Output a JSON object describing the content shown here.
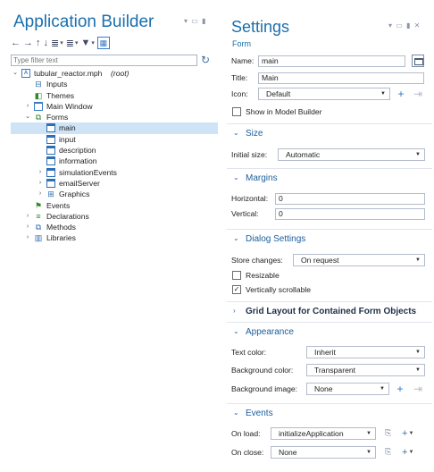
{
  "app_builder": {
    "title": "Application Builder",
    "filter_placeholder": "Type filter text",
    "tree": [
      {
        "label": "tubular_reactor.mph",
        "suffix": "(root)",
        "level": 0,
        "expanded": true,
        "icon": "application-icon"
      },
      {
        "label": "Inputs",
        "level": 1,
        "icon": "inputs-icon"
      },
      {
        "label": "Themes",
        "level": 1,
        "icon": "themes-icon"
      },
      {
        "label": "Main Window",
        "level": 1,
        "collapsed": true,
        "icon": "main-window-icon"
      },
      {
        "label": "Forms",
        "level": 1,
        "expanded": true,
        "icon": "forms-icon"
      },
      {
        "label": "main",
        "level": 2,
        "selected": true,
        "icon": "form-icon"
      },
      {
        "label": "input",
        "level": 2,
        "icon": "form-icon"
      },
      {
        "label": "description",
        "level": 2,
        "icon": "form-icon"
      },
      {
        "label": "information",
        "level": 2,
        "icon": "form-icon"
      },
      {
        "label": "simulationEvents",
        "level": 2,
        "collapsed": true,
        "icon": "form-icon"
      },
      {
        "label": "emailServer",
        "level": 2,
        "collapsed": true,
        "icon": "form-icon"
      },
      {
        "label": "Graphics",
        "level": 2,
        "collapsed": true,
        "icon": "graphics-icon"
      },
      {
        "label": "Events",
        "level": 1,
        "icon": "events-icon"
      },
      {
        "label": "Declarations",
        "level": 1,
        "collapsed": true,
        "icon": "declarations-icon"
      },
      {
        "label": "Methods",
        "level": 1,
        "collapsed": true,
        "icon": "methods-icon"
      },
      {
        "label": "Libraries",
        "level": 1,
        "collapsed": true,
        "icon": "libraries-icon"
      }
    ]
  },
  "settings": {
    "title": "Settings",
    "subtitle": "Form",
    "name_label": "Name:",
    "name_value": "main",
    "title_label": "Title:",
    "title_value": "Main",
    "icon_label": "Icon:",
    "icon_value": "Default",
    "show_in_model_builder": "Show in Model Builder",
    "sections": {
      "size": "Size",
      "margins": "Margins",
      "dialog": "Dialog Settings",
      "grid": "Grid Layout for Contained Form Objects",
      "appearance": "Appearance",
      "events": "Events"
    },
    "initial_size_label": "Initial size:",
    "initial_size_value": "Automatic",
    "horizontal_label": "Horizontal:",
    "horizontal_value": "0",
    "vertical_label": "Vertical:",
    "vertical_value": "0",
    "store_changes_label": "Store changes:",
    "store_changes_value": "On request",
    "resizable_label": "Resizable",
    "resizable_checked": false,
    "vertically_scrollable_label": "Vertically scrollable",
    "vertically_scrollable_checked": true,
    "text_color_label": "Text color:",
    "text_color_value": "Inherit",
    "bg_color_label": "Background color:",
    "bg_color_value": "Transparent",
    "bg_image_label": "Background image:",
    "bg_image_value": "None",
    "on_load_label": "On load:",
    "on_load_value": "initializeApplication",
    "on_close_label": "On close:",
    "on_close_value": "None"
  },
  "colors": {
    "accent": "#1a6fae",
    "selection": "#cfe3f7"
  }
}
